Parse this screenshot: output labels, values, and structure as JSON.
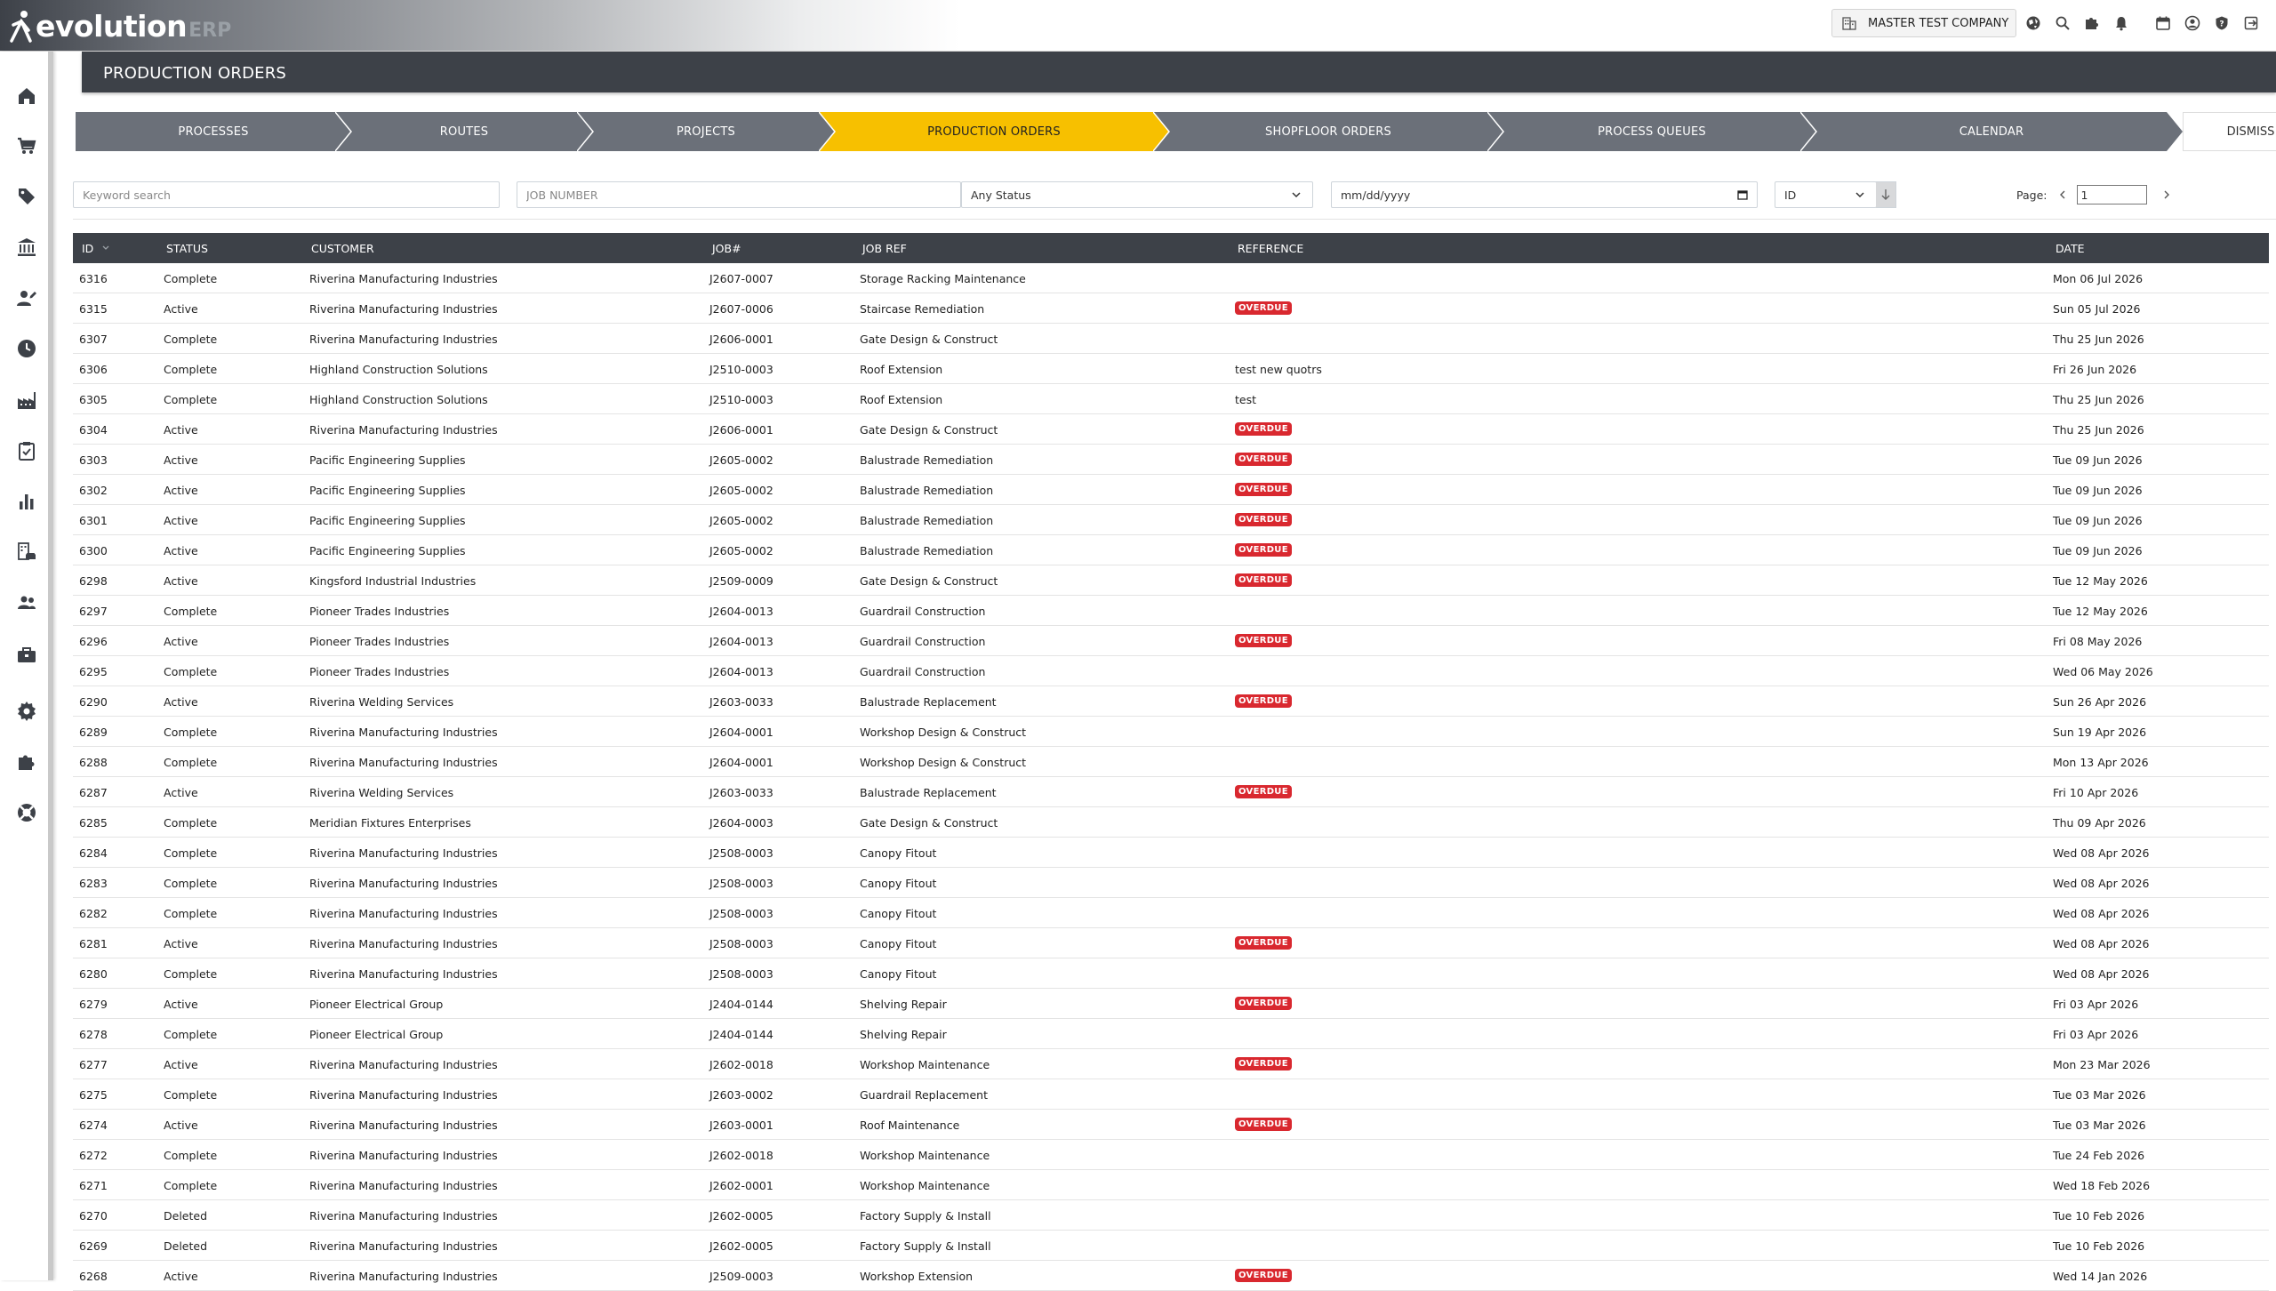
{
  "app": {
    "logo_text": "evolution",
    "logo_suffix": "ERP"
  },
  "topbar": {
    "company": "MASTER TEST COMPANY",
    "icons": [
      "globe-icon",
      "search-icon",
      "puzzle-icon",
      "bell-icon",
      "calendar-icon",
      "user-icon",
      "help-icon",
      "logout-icon"
    ]
  },
  "sidebar": {
    "items": [
      "home-icon",
      "cart-icon",
      "tag-icon",
      "bank-icon",
      "user-edit-icon",
      "clock-icon",
      "factory-icon",
      "clipboard-check-icon",
      "bar-chart-icon",
      "building-car-icon",
      "users-icon",
      "toolbox-icon",
      "settings-icon",
      "puzzle-icon",
      "lifebuoy-icon"
    ]
  },
  "page": {
    "title": "PRODUCTION ORDERS"
  },
  "steps": [
    {
      "label": "PROCESSES",
      "active": false
    },
    {
      "label": "ROUTES",
      "active": false
    },
    {
      "label": "PROJECTS",
      "active": false
    },
    {
      "label": "PRODUCTION ORDERS",
      "active": true
    },
    {
      "label": "SHOPFLOOR ORDERS",
      "active": false
    },
    {
      "label": "PROCESS QUEUES",
      "active": false
    },
    {
      "label": "CALENDAR",
      "active": false
    }
  ],
  "dismiss_label": "DISMISS",
  "filters": {
    "keyword_placeholder": "Keyword search",
    "job_placeholder": "JOB NUMBER",
    "status_value": "Any Status",
    "date_value": "mm/dd/yyyy",
    "sort_value": "ID",
    "page_label": "Page:",
    "page_value": "1"
  },
  "colors": {
    "accent": "#f7c000",
    "dark": "#3d4148",
    "overdue": "#d9282f"
  },
  "table": {
    "columns": [
      "ID",
      "STATUS",
      "CUSTOMER",
      "JOB#",
      "JOB REF",
      "REFERENCE",
      "DATE"
    ],
    "rows": [
      {
        "id": "6316",
        "status": "Complete",
        "customer": "Riverina Manufacturing Industries",
        "job": "J2607-0007",
        "ref": "Storage Racking Maintenance",
        "reference": "",
        "overdue": false,
        "date": "Mon 06 Jul 2026"
      },
      {
        "id": "6315",
        "status": "Active",
        "customer": "Riverina Manufacturing Industries",
        "job": "J2607-0006",
        "ref": "Staircase Remediation",
        "reference": "",
        "overdue": true,
        "date": "Sun 05 Jul 2026"
      },
      {
        "id": "6307",
        "status": "Complete",
        "customer": "Riverina Manufacturing Industries",
        "job": "J2606-0001",
        "ref": "Gate Design & Construct",
        "reference": "",
        "overdue": false,
        "date": "Thu 25 Jun 2026"
      },
      {
        "id": "6306",
        "status": "Complete",
        "customer": "Highland Construction Solutions",
        "job": "J2510-0003",
        "ref": "Roof Extension",
        "reference": "test new quotrs",
        "overdue": false,
        "date": "Fri 26 Jun 2026"
      },
      {
        "id": "6305",
        "status": "Complete",
        "customer": "Highland Construction Solutions",
        "job": "J2510-0003",
        "ref": "Roof Extension",
        "reference": "test",
        "overdue": false,
        "date": "Thu 25 Jun 2026"
      },
      {
        "id": "6304",
        "status": "Active",
        "customer": "Riverina Manufacturing Industries",
        "job": "J2606-0001",
        "ref": "Gate Design & Construct",
        "reference": "",
        "overdue": true,
        "date": "Thu 25 Jun 2026"
      },
      {
        "id": "6303",
        "status": "Active",
        "customer": "Pacific Engineering Supplies",
        "job": "J2605-0002",
        "ref": "Balustrade Remediation",
        "reference": "",
        "overdue": true,
        "date": "Tue 09 Jun 2026"
      },
      {
        "id": "6302",
        "status": "Active",
        "customer": "Pacific Engineering Supplies",
        "job": "J2605-0002",
        "ref": "Balustrade Remediation",
        "reference": "",
        "overdue": true,
        "date": "Tue 09 Jun 2026"
      },
      {
        "id": "6301",
        "status": "Active",
        "customer": "Pacific Engineering Supplies",
        "job": "J2605-0002",
        "ref": "Balustrade Remediation",
        "reference": "",
        "overdue": true,
        "date": "Tue 09 Jun 2026"
      },
      {
        "id": "6300",
        "status": "Active",
        "customer": "Pacific Engineering Supplies",
        "job": "J2605-0002",
        "ref": "Balustrade Remediation",
        "reference": "",
        "overdue": true,
        "date": "Tue 09 Jun 2026"
      },
      {
        "id": "6298",
        "status": "Active",
        "customer": "Kingsford Industrial Industries",
        "job": "J2509-0009",
        "ref": "Gate Design & Construct",
        "reference": "",
        "overdue": true,
        "date": "Tue 12 May 2026"
      },
      {
        "id": "6297",
        "status": "Complete",
        "customer": "Pioneer Trades Industries",
        "job": "J2604-0013",
        "ref": "Guardrail Construction",
        "reference": "",
        "overdue": false,
        "date": "Tue 12 May 2026"
      },
      {
        "id": "6296",
        "status": "Active",
        "customer": "Pioneer Trades Industries",
        "job": "J2604-0013",
        "ref": "Guardrail Construction",
        "reference": "",
        "overdue": true,
        "date": "Fri 08 May 2026"
      },
      {
        "id": "6295",
        "status": "Complete",
        "customer": "Pioneer Trades Industries",
        "job": "J2604-0013",
        "ref": "Guardrail Construction",
        "reference": "",
        "overdue": false,
        "date": "Wed 06 May 2026"
      },
      {
        "id": "6290",
        "status": "Active",
        "customer": "Riverina Welding Services",
        "job": "J2603-0033",
        "ref": "Balustrade Replacement",
        "reference": "",
        "overdue": true,
        "date": "Sun 26 Apr 2026"
      },
      {
        "id": "6289",
        "status": "Complete",
        "customer": "Riverina Manufacturing Industries",
        "job": "J2604-0001",
        "ref": "Workshop Design & Construct",
        "reference": "",
        "overdue": false,
        "date": "Sun 19 Apr 2026"
      },
      {
        "id": "6288",
        "status": "Complete",
        "customer": "Riverina Manufacturing Industries",
        "job": "J2604-0001",
        "ref": "Workshop Design & Construct",
        "reference": "",
        "overdue": false,
        "date": "Mon 13 Apr 2026"
      },
      {
        "id": "6287",
        "status": "Active",
        "customer": "Riverina Welding Services",
        "job": "J2603-0033",
        "ref": "Balustrade Replacement",
        "reference": "",
        "overdue": true,
        "date": "Fri 10 Apr 2026"
      },
      {
        "id": "6285",
        "status": "Complete",
        "customer": "Meridian Fixtures Enterprises",
        "job": "J2604-0003",
        "ref": "Gate Design & Construct",
        "reference": "",
        "overdue": false,
        "date": "Thu 09 Apr 2026"
      },
      {
        "id": "6284",
        "status": "Complete",
        "customer": "Riverina Manufacturing Industries",
        "job": "J2508-0003",
        "ref": "Canopy Fitout",
        "reference": "",
        "overdue": false,
        "date": "Wed 08 Apr 2026"
      },
      {
        "id": "6283",
        "status": "Complete",
        "customer": "Riverina Manufacturing Industries",
        "job": "J2508-0003",
        "ref": "Canopy Fitout",
        "reference": "",
        "overdue": false,
        "date": "Wed 08 Apr 2026"
      },
      {
        "id": "6282",
        "status": "Complete",
        "customer": "Riverina Manufacturing Industries",
        "job": "J2508-0003",
        "ref": "Canopy Fitout",
        "reference": "",
        "overdue": false,
        "date": "Wed 08 Apr 2026"
      },
      {
        "id": "6281",
        "status": "Active",
        "customer": "Riverina Manufacturing Industries",
        "job": "J2508-0003",
        "ref": "Canopy Fitout",
        "reference": "",
        "overdue": true,
        "date": "Wed 08 Apr 2026"
      },
      {
        "id": "6280",
        "status": "Complete",
        "customer": "Riverina Manufacturing Industries",
        "job": "J2508-0003",
        "ref": "Canopy Fitout",
        "reference": "",
        "overdue": false,
        "date": "Wed 08 Apr 2026"
      },
      {
        "id": "6279",
        "status": "Active",
        "customer": "Pioneer Electrical Group",
        "job": "J2404-0144",
        "ref": "Shelving Repair",
        "reference": "",
        "overdue": true,
        "date": "Fri 03 Apr 2026"
      },
      {
        "id": "6278",
        "status": "Complete",
        "customer": "Pioneer Electrical Group",
        "job": "J2404-0144",
        "ref": "Shelving Repair",
        "reference": "",
        "overdue": false,
        "date": "Fri 03 Apr 2026"
      },
      {
        "id": "6277",
        "status": "Active",
        "customer": "Riverina Manufacturing Industries",
        "job": "J2602-0018",
        "ref": "Workshop Maintenance",
        "reference": "",
        "overdue": true,
        "date": "Mon 23 Mar 2026"
      },
      {
        "id": "6275",
        "status": "Complete",
        "customer": "Riverina Manufacturing Industries",
        "job": "J2603-0002",
        "ref": "Guardrail Replacement",
        "reference": "",
        "overdue": false,
        "date": "Tue 03 Mar 2026"
      },
      {
        "id": "6274",
        "status": "Active",
        "customer": "Riverina Manufacturing Industries",
        "job": "J2603-0001",
        "ref": "Roof Maintenance",
        "reference": "",
        "overdue": true,
        "date": "Tue 03 Mar 2026"
      },
      {
        "id": "6272",
        "status": "Complete",
        "customer": "Riverina Manufacturing Industries",
        "job": "J2602-0018",
        "ref": "Workshop Maintenance",
        "reference": "",
        "overdue": false,
        "date": "Tue 24 Feb 2026"
      },
      {
        "id": "6271",
        "status": "Complete",
        "customer": "Riverina Manufacturing Industries",
        "job": "J2602-0001",
        "ref": "Workshop Maintenance",
        "reference": "",
        "overdue": false,
        "date": "Wed 18 Feb 2026"
      },
      {
        "id": "6270",
        "status": "Deleted",
        "customer": "Riverina Manufacturing Industries",
        "job": "J2602-0005",
        "ref": "Factory Supply & Install",
        "reference": "",
        "overdue": false,
        "date": "Tue 10 Feb 2026"
      },
      {
        "id": "6269",
        "status": "Deleted",
        "customer": "Riverina Manufacturing Industries",
        "job": "J2602-0005",
        "ref": "Factory Supply & Install",
        "reference": "",
        "overdue": false,
        "date": "Tue 10 Feb 2026"
      },
      {
        "id": "6268",
        "status": "Active",
        "customer": "Riverina Manufacturing Industries",
        "job": "J2509-0003",
        "ref": "Workshop Extension",
        "reference": "",
        "overdue": true,
        "date": "Wed 14 Jan 2026"
      }
    ],
    "overdue_label": "OVERDUE"
  }
}
